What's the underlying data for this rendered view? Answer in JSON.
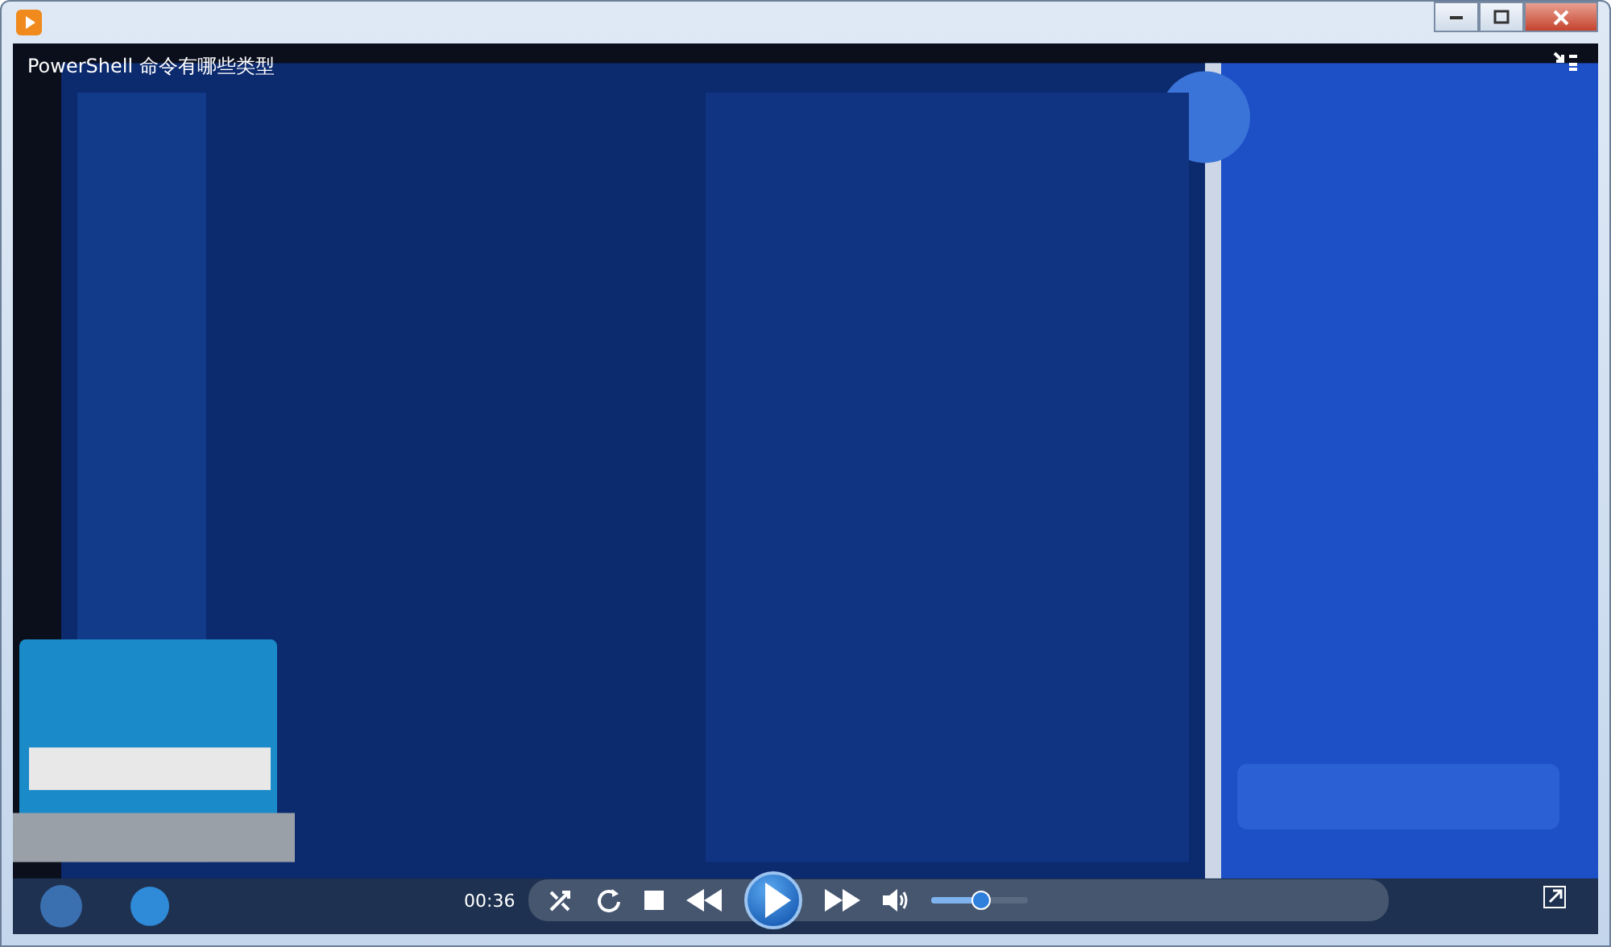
{
  "video": {
    "title": "PowerShell 命令有哪些类型",
    "kind": "picture"
  },
  "controls": {
    "time": "00:36",
    "playing": false,
    "volume": {
      "level": 0.5
    }
  }
}
